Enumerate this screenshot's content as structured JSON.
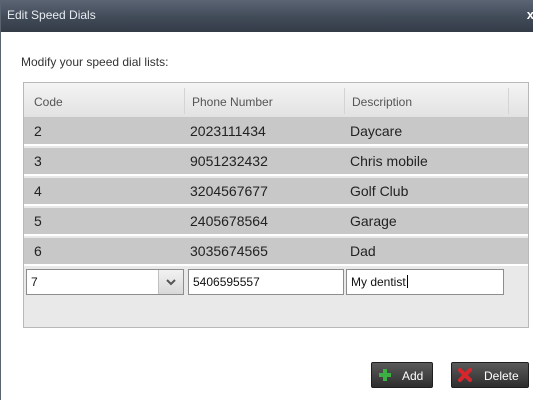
{
  "dialog": {
    "title": "Edit Speed Dials",
    "close_glyph": "x",
    "instruction": "Modify your speed dial lists:"
  },
  "grid": {
    "columns": [
      "Code",
      "Phone Number",
      "Description"
    ],
    "rows": [
      {
        "code": "2",
        "phone": "2023111434",
        "description": "Daycare"
      },
      {
        "code": "3",
        "phone": "9051232432",
        "description": "Chris mobile"
      },
      {
        "code": "4",
        "phone": "3204567677",
        "description": "Golf Club"
      },
      {
        "code": "5",
        "phone": "2405678564",
        "description": "Garage"
      },
      {
        "code": "6",
        "phone": "3035674565",
        "description": "Dad"
      }
    ],
    "edit_row": {
      "code": "7",
      "phone": "5406595557",
      "description": "My dentist"
    }
  },
  "buttons": {
    "add_label": "Add",
    "add_icon": "plus-icon",
    "delete_label": "Delete",
    "delete_icon": "delete-x-icon"
  },
  "colors": {
    "titlebar": "#414a57",
    "row": "#c8c8c8",
    "add_icon": "#3cb043",
    "delete_icon": "#d9262c"
  }
}
